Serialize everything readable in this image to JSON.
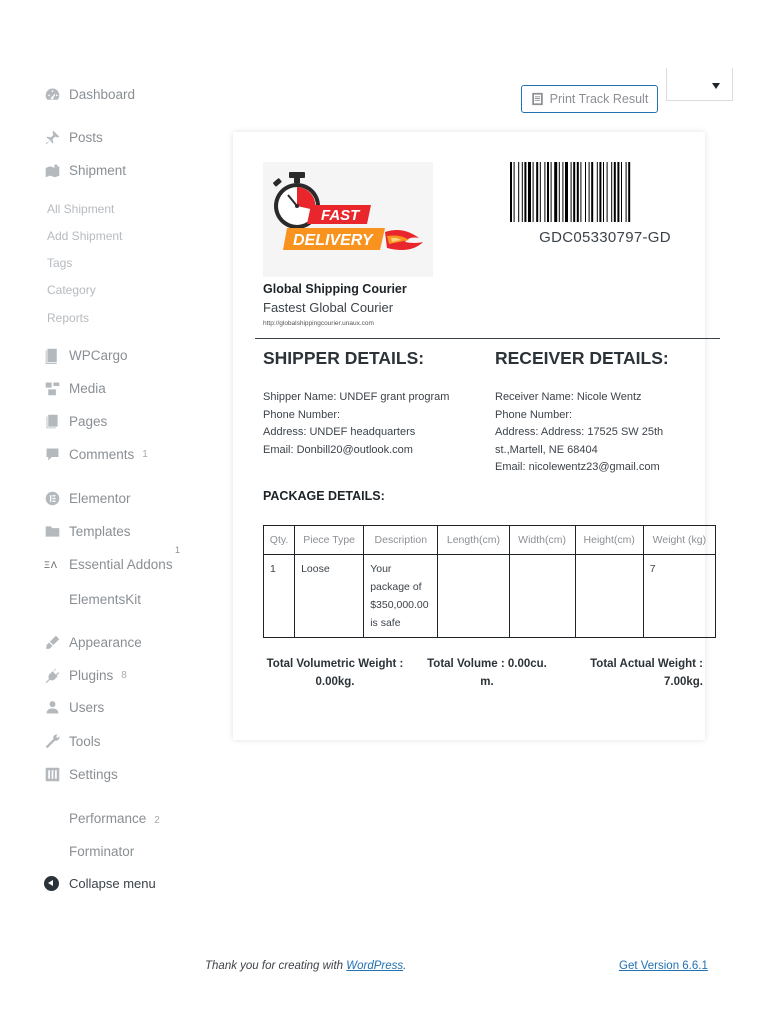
{
  "sidebar": {
    "dashboard": "Dashboard",
    "posts": "Posts",
    "shipment": "Shipment",
    "shipment_sub": [
      "All Shipment",
      "Add Shipment",
      "Tags",
      "Category",
      "Reports"
    ],
    "wpcargo": "WPCargo",
    "media": "Media",
    "pages": "Pages",
    "comments": "Comments",
    "comments_count": "1",
    "elementor": "Elementor",
    "templates": "Templates",
    "essential_addons": "Essential Addons",
    "essential_addons_count": "1",
    "elementskit": "ElementsKit",
    "appearance": "Appearance",
    "plugins": "Plugins",
    "plugins_count": "8",
    "users": "Users",
    "tools": "Tools",
    "settings": "Settings",
    "performance": "Performance",
    "performance_count": "2",
    "forminator": "Forminator",
    "collapse": "Collapse menu"
  },
  "toolbar": {
    "print_label": "Print Track Result"
  },
  "logo": {
    "line1": "FAST",
    "line2": "DELIVERY"
  },
  "shipment": {
    "tracking_number": "GDC05330797-GD",
    "company_name": "Global Shipping Courier",
    "company_tagline": "Fastest Global Courier",
    "company_url": "http://globalshippingcourier.unaux.com",
    "shipper": {
      "title": "SHIPPER DETAILS:",
      "name": "Shipper Name: UNDEF grant program",
      "phone": "Phone Number:",
      "address": "Address: UNDEF headquarters",
      "email": "Email: Donbill20@outlook.com"
    },
    "receiver": {
      "title": "RECEIVER DETAILS:",
      "name": "Receiver Name: Nicole Wentz",
      "phone": "Phone Number:",
      "address": "Address: Address: 17525 SW 25th st.,Martell, NE 68404",
      "email": "Email: nicolewentz23@gmail.com"
    },
    "package": {
      "title": "PACKAGE DETAILS:",
      "headers": [
        "Qty.",
        "Piece Type",
        "Description",
        "Length(cm)",
        "Width(cm)",
        "Height(cm)",
        "Weight (kg)"
      ],
      "rows": [
        [
          "1",
          "Loose",
          "Your package of $350,000.00 is safe",
          "",
          "",
          "",
          "7"
        ]
      ]
    },
    "totals": {
      "volumetric": "Total Volumetric Weight : 0.00kg.",
      "volume": "Total Volume : 0.00cu. m.",
      "actual": "Total Actual Weight : 7.00kg."
    }
  },
  "footer": {
    "thanks_prefix": "Thank you for creating with ",
    "thanks_link": "WordPress",
    "thanks_suffix": ".",
    "version_link": "Get Version 6.6.1"
  },
  "colors": {
    "accent": "#2271b1",
    "logo_red": "#e8262b",
    "logo_orange": "#f7931e"
  }
}
